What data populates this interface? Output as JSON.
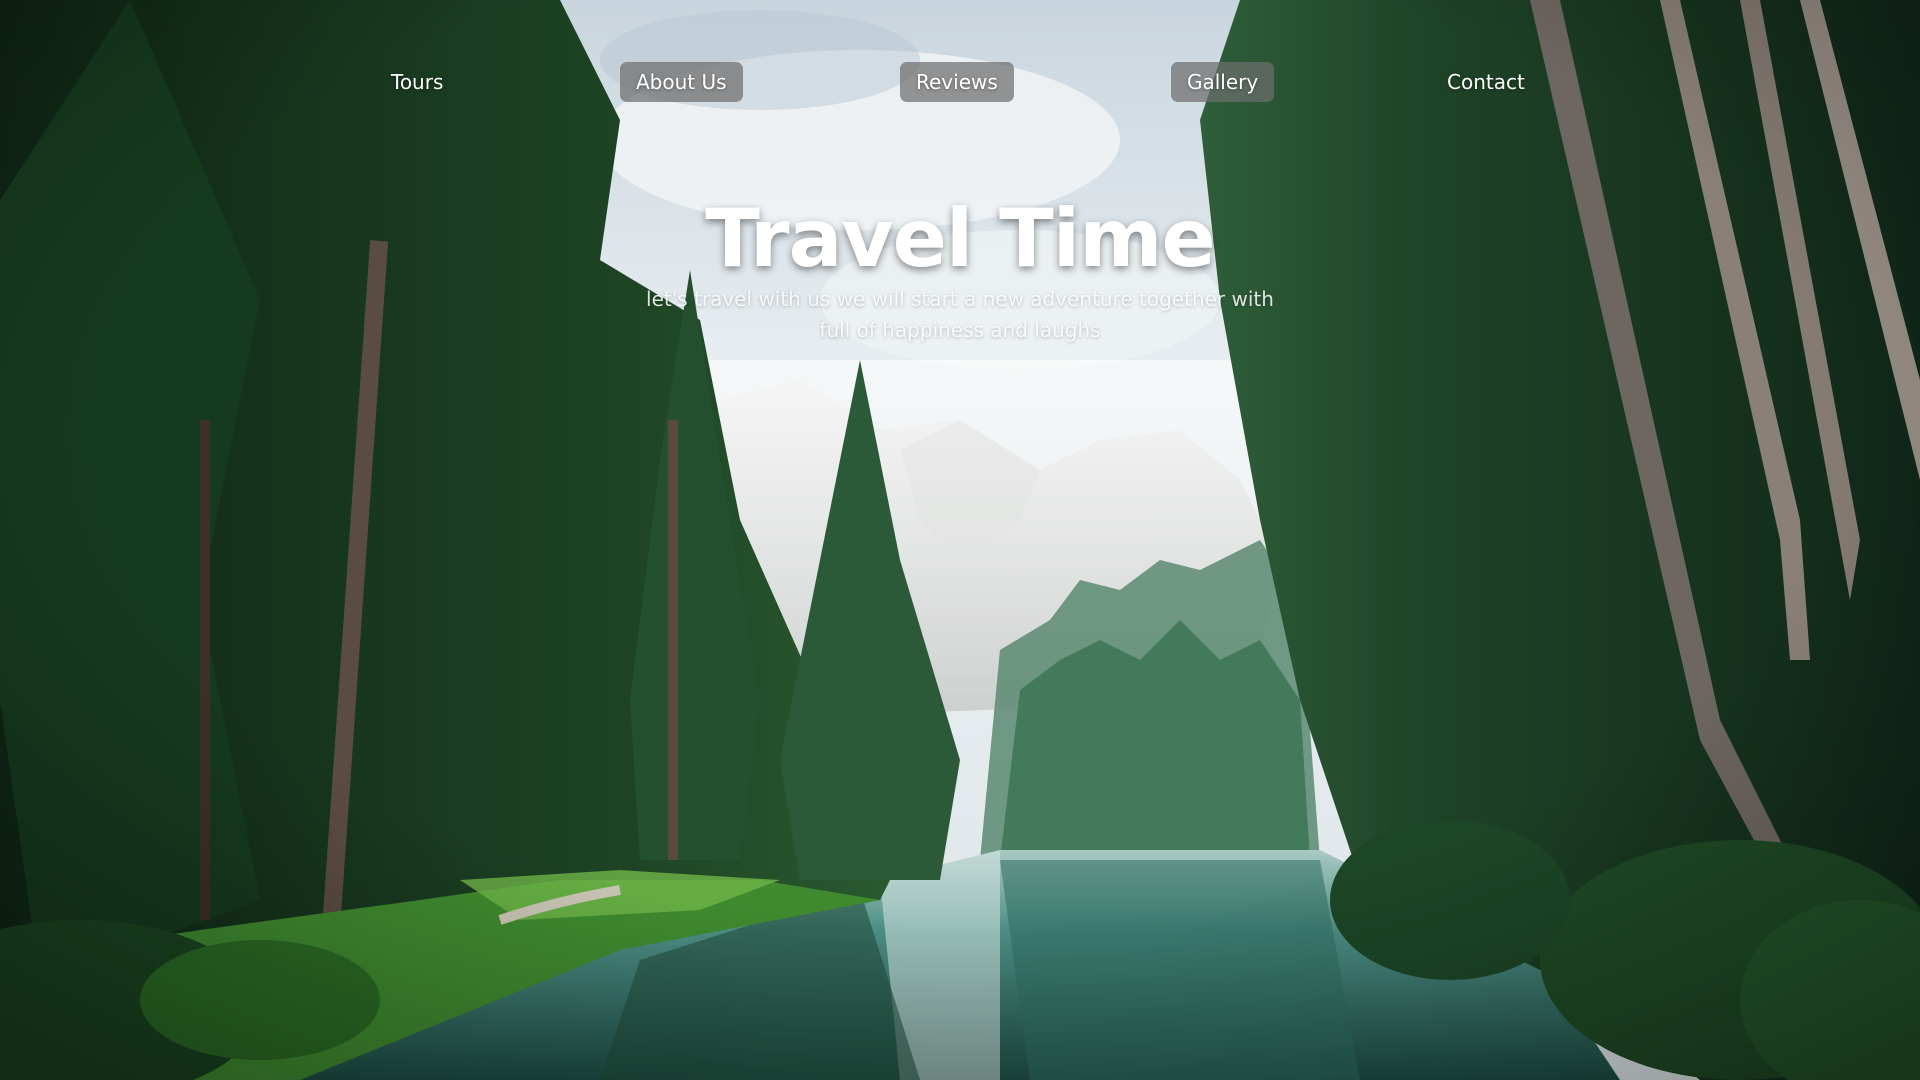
{
  "nav": {
    "items": [
      {
        "label": "Tours"
      },
      {
        "label": "About Us"
      },
      {
        "label": "Reviews"
      },
      {
        "label": "Gallery"
      },
      {
        "label": "Contact"
      }
    ]
  },
  "hero": {
    "title": "Travel Time",
    "subtitle": "let's travel with us we will start a new adventure together with full of happiness and laughs",
    "background": "forest-lake-mountain-photo"
  },
  "colors": {
    "nav_text": "#ffffff",
    "nav_active_bg": "#6e6e6e",
    "title": "#ffffff",
    "forest_dark": "#17301f",
    "lake": "#3f8a80",
    "sky": "#dfe7ec"
  }
}
